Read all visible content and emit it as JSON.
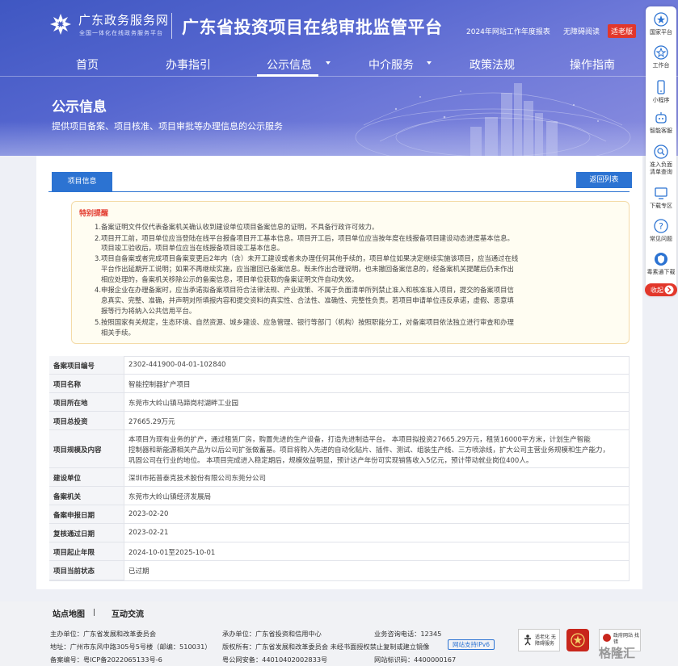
{
  "header": {
    "portal_name": "广东政务服务网",
    "portal_slogan": "全国一体化在线政务服务平台",
    "platform_title": "广东省投资项目在线审批监管平台",
    "links": {
      "annual_report": "2024年网站工作年度报表",
      "accessibility": "无障碍阅读",
      "elder_mode": "适老版"
    }
  },
  "nav": {
    "items": [
      "首页",
      "办事指引",
      "公示信息",
      "中介服务",
      "政策法规",
      "操作指南"
    ],
    "active": "公示信息"
  },
  "banner": {
    "title": "公示信息",
    "subtitle": "提供项目备案、项目核准、项目审批等办理信息的公示服务"
  },
  "sidebar": {
    "items": [
      "国家平台",
      "工作台",
      "小程序",
      "智能客服",
      "准入负面清单查询",
      "下载专区",
      "常见问题",
      "毒素通下载"
    ],
    "collapse_label": "收起"
  },
  "tab": {
    "label": "项目信息"
  },
  "back_button": "返回列表",
  "notice": {
    "title": "特别提醒",
    "lines": [
      "1.备案证明文件仅代表备案机关确认收到建设单位项目备案信息的证明，不具备行政许可效力。",
      "2.项目开工前，项目单位应当登陆在线平台报备项目开工基本信息。项目开工后，项目单位应当按年度在线报备项目建设动态进度基本信息。",
      "项目竣工验收后，项目单位应当在线报备项目竣工基本信息。",
      "3.项目自备案或者完成项目备案变更后2年内（含）未开工建设或者未办理任何其他手续的，项目单位如果决定继续实施该项目，应当通过在线",
      "平台作出延期开工说明；如果不再继续实施，应当撤回已备案信息。既未作出合理说明，也未撤回备案信息的，经备案机关提醒后仍未作出",
      "相应处理的，备案机关移除公示的备案信息，项目单位获取的备案证明文件自动失效。",
      "4.申报企业在办理备案时，应当承诺拟备案项目符合法律法规、产业政策、不属于负面清单所列禁止准入和核准准入项目，提交的备案项目信",
      "息真实、完整、准确，并声明对所填报内容和提交资料的真实性、合法性、准确性、完整性负责。若项目申请单位违反承诺，虚假、恶意填",
      "报等行为将纳入公共信用平台。",
      "5.按照国家有关规定，生态环境、自然资源、城乡建设、应急管理、银行等部门（机构）按照职能分工，对备案项目依法独立进行审查和办理",
      "相关手续。"
    ]
  },
  "project": {
    "rows": [
      {
        "label": "备案项目编号",
        "value": "2302-441900-04-01-102840"
      },
      {
        "label": "项目名称",
        "value": "智能控制器扩产项目"
      },
      {
        "label": "项目所在地",
        "value": "东莞市大岭山镇马蹄岗村湖畔工业园"
      },
      {
        "label": "项目总投资",
        "value": "27665.29万元"
      },
      {
        "label": "项目规模及内容",
        "value_lines": [
          "本项目为现有业务的扩产，通过租赁厂房，购置先进的生产设备，打造先进制造平台。         本项目拟投资27665.29万元，租赁16000平方米，计划生产智能",
          "控制器和新能源相关产品为以后公司扩张做蓄基。项目将购入先进的自动化贴片、插件、测试、组装生产线、三方喷涂线，扩大公司主营业务规模和生产能力，",
          "巩固公司在行业的地位。         本项目完成进入稳定期后，规模效益明显，预计达产年份可实现销售收入5亿元，预计带动就业岗位400人。"
        ]
      },
      {
        "label": "建设单位",
        "value": "深圳市拓普泰克技术股份有限公司东莞分公司"
      },
      {
        "label": "备案机关",
        "value": "东莞市大岭山镇经济发展局"
      },
      {
        "label": "备案申报日期",
        "value": "2023-02-20"
      },
      {
        "label": "复核通过日期",
        "value": "2023-02-21"
      },
      {
        "label": "项目起止年限",
        "value": "2024-10-01至2025-10-01"
      },
      {
        "label": "项目当前状态",
        "value": "已过期"
      }
    ]
  },
  "footer": {
    "links": [
      "站点地图",
      "互动交流"
    ],
    "sponsor": "主办单位：广东省发展和改革委员会",
    "organizer": "承办单位：广东省投资和信用中心",
    "phone": "业务咨询电话：12345",
    "address": "地址：广州市东风中路305号5号楼（邮编：510031）",
    "copyright": "版权所有：广东省发展和改革委员会 未经书面授权禁止复制或建立镜像",
    "ipv6": "网站支持IPv6",
    "icp": "备案编号：粤ICP备2022065133号-6",
    "police": "粤公网安备：44010402002833号",
    "site_code": "网站标识码：4400000167",
    "badge_a": "适老化 无障碍服务",
    "badge_c": "政府网站 找错",
    "watermark": "格隆汇"
  },
  "colors": {
    "primary": "#2c73d2",
    "alert": "#e2372b",
    "hero": "#4b5fc9"
  }
}
